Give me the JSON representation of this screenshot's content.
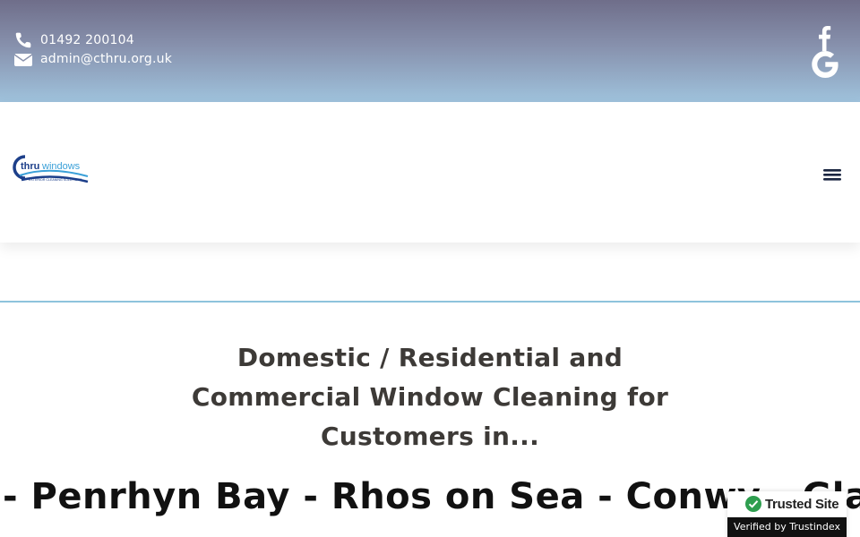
{
  "topbar": {
    "phone": "01492 200104",
    "email": "admin@cthru.org.uk",
    "icons": [
      "phone-icon",
      "envelope-icon"
    ],
    "social": [
      "facebook-icon",
      "google-icon"
    ]
  },
  "header": {
    "logo": {
      "brand_c": "C",
      "brand_thru": "thru",
      "brand_windows": "windows",
      "tagline": "EXTERIOR CLEANING SOLUTIONS"
    },
    "menu_icon": "hamburger-menu-icon"
  },
  "hero": {
    "headline": "Domestic / Residential and Commercial Window Cleaning for Customers in...",
    "locations_text": "- Penrhyn Bay - Rhos on Sea - Conwy - Glan"
  },
  "trust_badge": {
    "title": "Trusted Site",
    "verified": "Verified by Trustindex"
  },
  "colors": {
    "heading": "#3d3a37",
    "divider": "#8ec3dc",
    "check_green": "#2e9e4f"
  }
}
